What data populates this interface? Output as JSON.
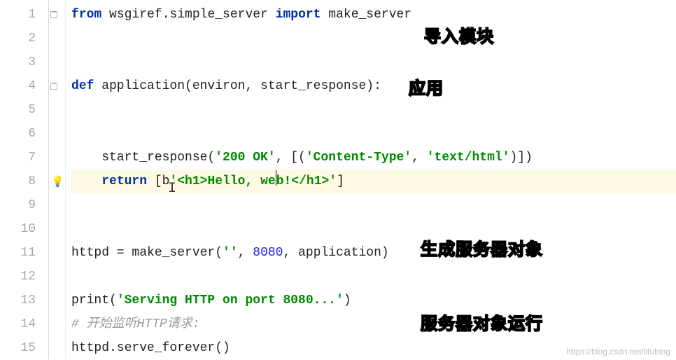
{
  "lines": {
    "n1": "1",
    "n2": "2",
    "n3": "3",
    "n4": "4",
    "n5": "5",
    "n6": "6",
    "n7": "7",
    "n8": "8",
    "n9": "9",
    "n10": "10",
    "n11": "11",
    "n12": "12",
    "n13": "13",
    "n14": "14",
    "n15": "15"
  },
  "code": {
    "l1_from": "from",
    "l1_mod": " wsgiref.simple_server ",
    "l1_import": "import",
    "l1_name": " make_server",
    "l4_def": "def",
    "l4_sig": " application(environ, start_response):",
    "l7": "    start_response(",
    "l7_s1": "'200 OK'",
    "l7_c1": ", [(",
    "l7_s2": "'Content-Type'",
    "l7_c2": ", ",
    "l7_s3": "'text/html'",
    "l7_c3": ")])",
    "l8_ret": "return",
    "l8_a": " [",
    "l8_b": "b",
    "l8_str_a": "'<h1>Hello, we",
    "l8_str_b": "b!</h1>'",
    "l8_c": "]",
    "l11_a": "httpd = make_server(",
    "l11_s": "''",
    "l11_b": ", ",
    "l11_num": "8080",
    "l11_c": ", application)",
    "l13_a": "print(",
    "l13_s": "'Serving HTTP on port 8080...'",
    "l13_b": ")",
    "l14": "# 开始监听HTTP请求:",
    "l15": "httpd.serve_forever()"
  },
  "annotations": {
    "a1": "导入模块",
    "a2": "应用",
    "a3": "生成服务器对象",
    "a4": "服务器对象运行"
  },
  "icons": {
    "bulb": "💡"
  },
  "watermark": "https://blog.csdn.net/lifubing"
}
